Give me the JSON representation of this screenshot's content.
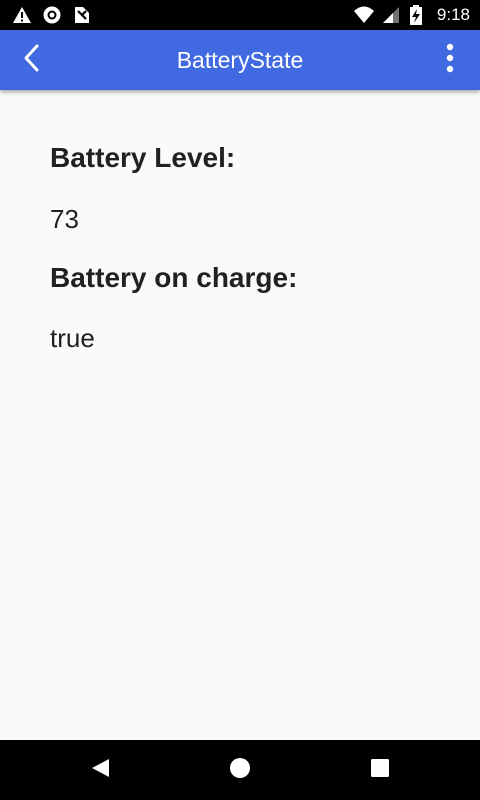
{
  "status_bar": {
    "time": "9:18",
    "left_icons": [
      "warning-icon",
      "sync-circle-icon",
      "no-sim-icon"
    ],
    "right_icons": [
      "wifi-icon",
      "cell-signal-icon",
      "battery-charging-icon"
    ]
  },
  "app_bar": {
    "title": "BatteryState",
    "background_color": "#4169e1",
    "back_icon": "chevron-left-icon",
    "menu_icon": "more-vertical-icon"
  },
  "content": {
    "level_label": "Battery Level:",
    "level_value": "73",
    "charge_label": "Battery on charge:",
    "charge_value": "true"
  },
  "nav_bar": {
    "back_icon": "triangle-back-icon",
    "home_icon": "circle-home-icon",
    "recents_icon": "square-recents-icon"
  }
}
